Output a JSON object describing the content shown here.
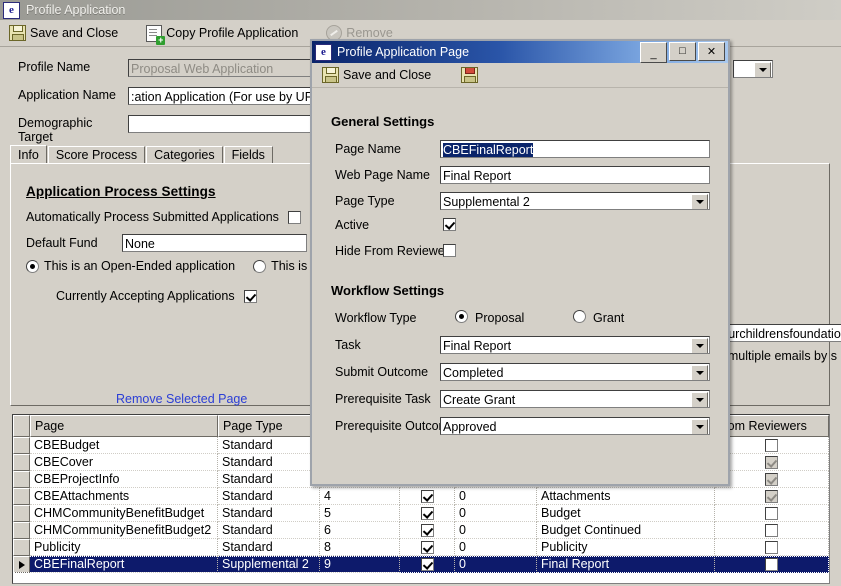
{
  "main_window": {
    "title": "Profile Application",
    "logo_glyph": "e",
    "toolbar": [
      {
        "label": "Save and Close",
        "icon": "floppy-icon",
        "disabled": false
      },
      {
        "label": "Copy Profile Application",
        "icon": "copy-document-icon",
        "disabled": false
      },
      {
        "label": "Remove",
        "icon": "remove-circle-icon",
        "disabled": true
      }
    ],
    "fields": {
      "profile_name_label": "Profile Name",
      "profile_name_value": "Proposal Web Application",
      "application_name_label": "Application Name",
      "application_name_value": ":ation Application (For use by UPeds, (",
      "demographic_target_label": "Demographic Target",
      "demographic_target_value": ""
    },
    "tabs": [
      {
        "label": "Info",
        "active": true
      },
      {
        "label": "Score Process",
        "active": false
      },
      {
        "label": "Categories",
        "active": false
      },
      {
        "label": "Fields",
        "active": false
      }
    ],
    "info_panel": {
      "heading": "Application Process Settings",
      "auto_process_label": "Automatically Process Submitted Applications",
      "auto_process_checked": false,
      "default_fund_label": "Default Fund",
      "default_fund_value": "None",
      "open_ended_label": "This is an Open-Ended application",
      "open_ended_selected": true,
      "cycle_label": "This is a Cyc",
      "cycle_selected": false,
      "accepting_label": "Currently Accepting Applications",
      "accepting_checked": true,
      "remove_selected_page_link": "Remove Selected Page",
      "partial_text_1": "yourchildrensfoundation",
      "partial_text_2": "te multiple emails by s"
    }
  },
  "grid": {
    "columns": [
      {
        "key": "page",
        "label": "Page"
      },
      {
        "key": "page_type",
        "label": "Page Type"
      },
      {
        "key": "order",
        "label": ""
      },
      {
        "key": "active",
        "label": ""
      },
      {
        "key": "num",
        "label": ""
      },
      {
        "key": "web_page_name",
        "label": ""
      },
      {
        "key": "hide_from_reviewers",
        "label": "from Reviewers"
      }
    ],
    "rows": [
      {
        "page": "CBEBudget",
        "page_type": "Standard",
        "order": "",
        "active": null,
        "num": "",
        "web_page_name": "",
        "hide": false,
        "hide_gray": false,
        "selected": false
      },
      {
        "page": "CBECover",
        "page_type": "Standard",
        "order": "",
        "active": null,
        "num": "",
        "web_page_name": "",
        "hide": true,
        "hide_gray": true,
        "selected": false
      },
      {
        "page": "CBEProjectInfo",
        "page_type": "Standard",
        "order": "",
        "active": null,
        "num": "",
        "web_page_name": "",
        "hide": true,
        "hide_gray": true,
        "selected": false
      },
      {
        "page": "CBEAttachments",
        "page_type": "Standard",
        "order": "4",
        "active": true,
        "num": "0",
        "web_page_name": "Attachments",
        "hide": true,
        "hide_gray": true,
        "selected": false
      },
      {
        "page": "CHMCommunityBenefitBudget",
        "page_type": "Standard",
        "order": "5",
        "active": true,
        "num": "0",
        "web_page_name": "Budget",
        "hide": false,
        "hide_gray": false,
        "selected": false
      },
      {
        "page": "CHMCommunityBenefitBudget2",
        "page_type": "Standard",
        "order": "6",
        "active": true,
        "num": "0",
        "web_page_name": "Budget Continued",
        "hide": false,
        "hide_gray": false,
        "selected": false
      },
      {
        "page": "Publicity",
        "page_type": "Standard",
        "order": "8",
        "active": true,
        "num": "0",
        "web_page_name": "Publicity",
        "hide": false,
        "hide_gray": false,
        "selected": false
      },
      {
        "page": "CBEFinalReport",
        "page_type": "Supplemental 2",
        "order": "9",
        "active": true,
        "num": "0",
        "web_page_name": "Final Report",
        "hide": false,
        "hide_gray": false,
        "selected": true
      }
    ]
  },
  "dialog": {
    "title": "Profile Application Page",
    "logo_glyph": "e",
    "window_buttons": {
      "minimize": "_",
      "maximize": "□",
      "close": "✕"
    },
    "toolbar": {
      "save_and_close_label": "Save and Close",
      "save_icon": "floppy-icon",
      "save_red_icon": "floppy-save-icon"
    },
    "general": {
      "heading": "General Settings",
      "page_name_label": "Page Name",
      "page_name_value": "CBEFinalReport",
      "web_page_name_label": "Web Page Name",
      "web_page_name_value": "Final Report",
      "page_type_label": "Page Type",
      "page_type_value": "Supplemental 2",
      "active_label": "Active",
      "active_checked": true,
      "hide_from_reviewers_label": "Hide From Reviewers",
      "hide_from_reviewers_checked": false
    },
    "workflow": {
      "heading": "Workflow Settings",
      "workflow_type_label": "Workflow Type",
      "proposal_label": "Proposal",
      "proposal_selected": true,
      "grant_label": "Grant",
      "grant_selected": false,
      "task_label": "Task",
      "task_value": "Final Report",
      "submit_outcome_label": "Submit Outcome",
      "submit_outcome_value": "Completed",
      "prerequisite_task_label": "Prerequisite Task",
      "prerequisite_task_value": "Create Grant",
      "prerequisite_outcome_label": "Prerequisite Outcome",
      "prerequisite_outcome_value": "Approved"
    }
  }
}
